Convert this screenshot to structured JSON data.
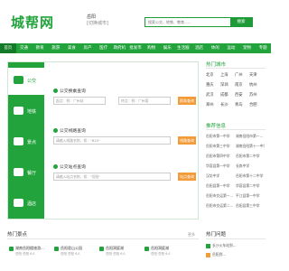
{
  "header": {
    "logo": "城帮网",
    "city": "岳阳",
    "city_switch": "[切换城市]",
    "search_placeholder": "搜索公交、地铁、教育......",
    "search_button": "搜索"
  },
  "nav": {
    "items": [
      "首页",
      "交通",
      "教育",
      "旅游",
      "美食",
      "房产",
      "医疗",
      "政府机构",
      "批发市场",
      "购物",
      "娱乐",
      "生活服务",
      "酒店",
      "休闲",
      "运动",
      "宠物",
      "专题"
    ]
  },
  "sidebar": {
    "items": [
      {
        "label": "公交",
        "icon": "bus-icon"
      },
      {
        "label": "地铁",
        "icon": "metro-icon"
      },
      {
        "label": "景点",
        "icon": "attraction-icon"
      },
      {
        "label": "餐厅",
        "icon": "restaurant-icon"
      },
      {
        "label": "酒店",
        "icon": "hotel-icon"
      }
    ]
  },
  "sections": {
    "transfer": {
      "title": "公交换乘查询",
      "from_placeholder": "起点：例：广州站",
      "to_placeholder": "终点：例：广州塔",
      "button": "换乘查询"
    },
    "line": {
      "title": "公交线路查询",
      "placeholder": "请输入线路名称，如：\"B25\"",
      "button": "线路查询"
    },
    "station": {
      "title": "公交站点查询",
      "placeholder": "请输入站点名称，如：\"岳阳\"",
      "button": "站点查询"
    }
  },
  "right": {
    "hot_cities_title": "热门城市",
    "hot_cities": [
      "北京",
      "上海",
      "广州",
      "天津",
      "重庆",
      "深圳",
      "南京",
      "杭州",
      "武汉",
      "成都",
      "西安",
      "苏州",
      "郑州",
      "长沙",
      "青岛",
      "合肥"
    ],
    "rec_title": "推荐信息",
    "rec_items": [
      "岳阳市第一中学",
      "湖南岳阳市第一...",
      "岳阳市第三中学",
      "湖南岳阳第十一中学",
      "岳阳市第四中学",
      "岳阳市第二中学",
      "华容县第一中学",
      "长炼中学",
      "汉坊中学",
      "岳阳市第十二中学",
      "岳阳县第一中学",
      "华容县第二中学",
      "岳阳市交运第一...",
      "平江县第一中学",
      "岳阳市交运第二...",
      "岳阳县第三中学"
    ]
  },
  "bottom": {
    "title": "热门景点",
    "more": "更多",
    "cards": [
      {
        "name": "湖南岳阳楼旅游...",
        "sub": "岳阳  岳阳  6人"
      },
      {
        "name": "岳阳君山公园",
        "sub": "岳阳  岳阳  6人"
      },
      {
        "name": "岳阳洞庭湖",
        "sub": "岳阳  岳阳  6人"
      },
      {
        "name": "岳阳洞庭湖",
        "sub": "岳阳  岳阳  6人"
      }
    ]
  },
  "right_bottom": {
    "title": "热门问题",
    "items": [
      "长沙火车站到...",
      "岳阳到..."
    ]
  },
  "colors": {
    "brand": "#22a33c",
    "accent": "#f29b38"
  }
}
